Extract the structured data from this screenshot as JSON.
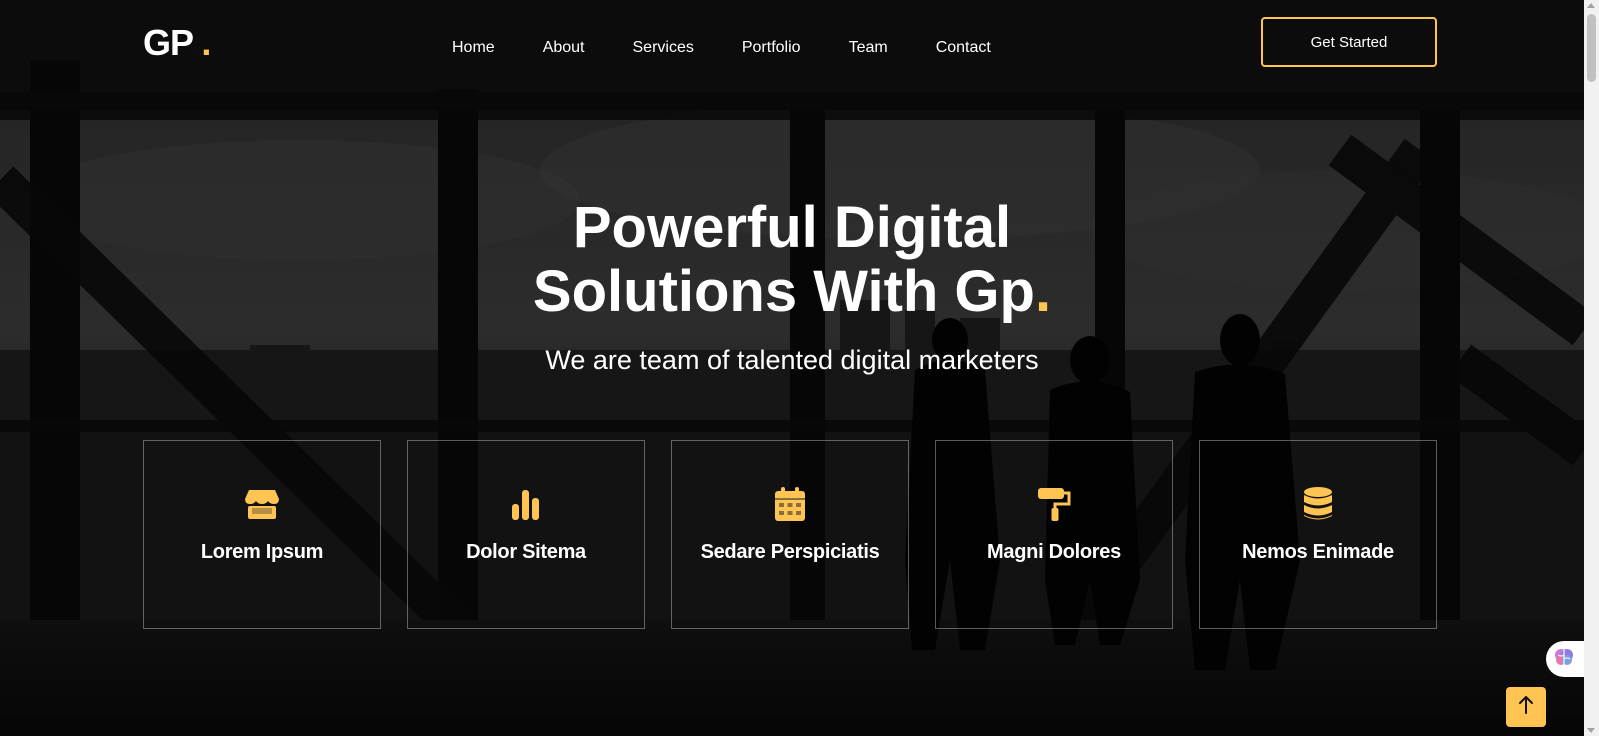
{
  "header": {
    "logo_text": "GP",
    "logo_dot": ".",
    "nav": [
      {
        "label": "Home"
      },
      {
        "label": "About"
      },
      {
        "label": "Services"
      },
      {
        "label": "Portfolio"
      },
      {
        "label": "Team"
      },
      {
        "label": "Contact"
      }
    ],
    "cta_label": "Get Started"
  },
  "hero": {
    "title_line1": "Powerful Digital",
    "title_line2": "Solutions With Gp",
    "title_dot": ".",
    "subtitle": "We are team of talented digital marketers"
  },
  "features": [
    {
      "title": "Lorem Ipsum",
      "icon": "store-icon"
    },
    {
      "title": "Dolor Sitema",
      "icon": "bar-chart-icon"
    },
    {
      "title": "Sedare Perspiciatis",
      "icon": "calendar-icon"
    },
    {
      "title": "Magni Dolores",
      "icon": "paint-roller-icon"
    },
    {
      "title": "Nemos Enimade",
      "icon": "database-icon"
    }
  ],
  "widgets": {
    "side_icon": "brain-icon",
    "back_to_top_icon": "arrow-up-icon"
  },
  "colors": {
    "accent": "#ffc451",
    "text": "#ffffff",
    "background": "#0c0c0c"
  }
}
